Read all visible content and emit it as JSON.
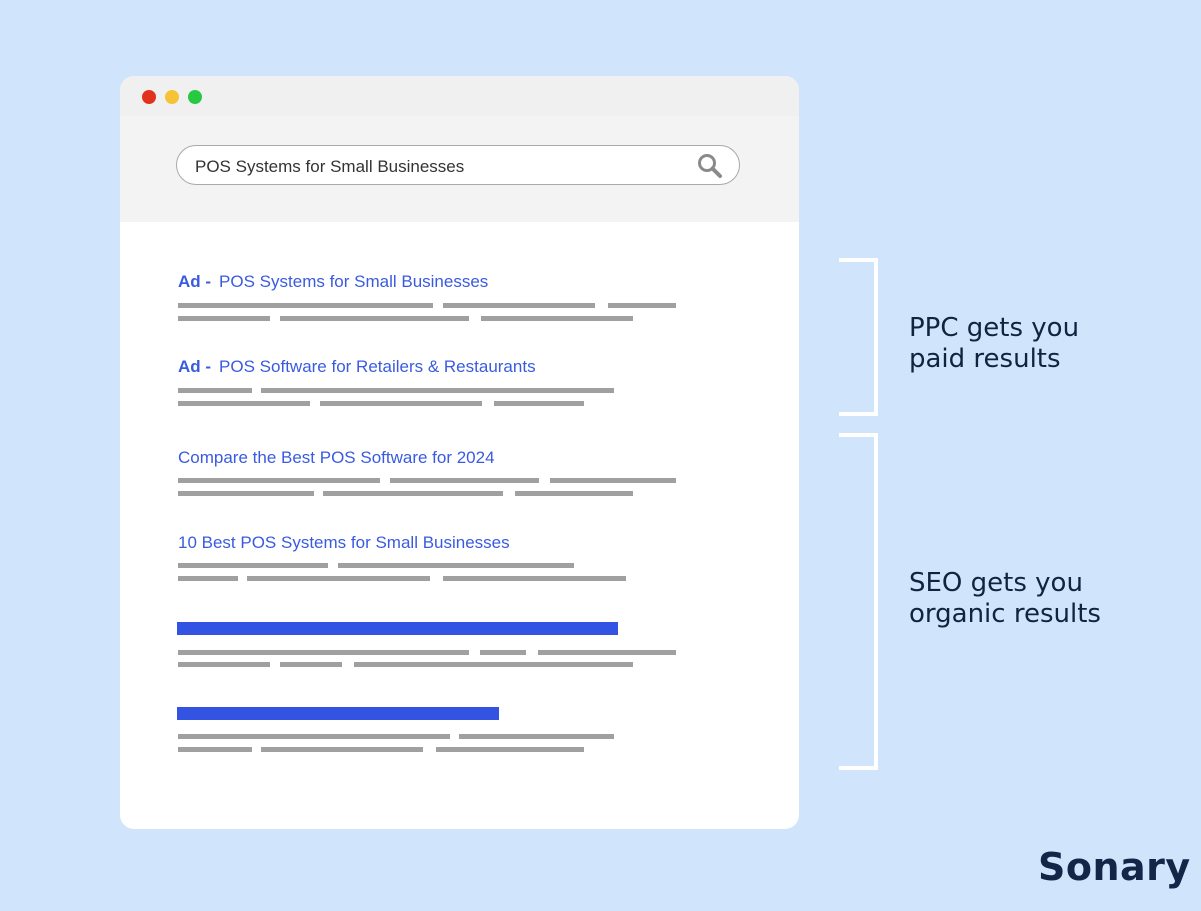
{
  "search": {
    "query": "POS Systems for Small Businesses"
  },
  "results": [
    {
      "ad": "Ad -",
      "title": "POS Systems for Small Businesses"
    },
    {
      "ad": "Ad -",
      "title": "POS Software for Retailers & Restaurants"
    },
    {
      "title": "Compare the Best POS Software for 2024"
    },
    {
      "title": "10 Best POS Systems for Small Businesses"
    }
  ],
  "labels": {
    "ppc": {
      "line1": "PPC gets you",
      "line2": "paid results"
    },
    "seo": {
      "line1": "SEO gets you",
      "line2": "organic results"
    }
  },
  "brand": {
    "name": "Sonary"
  },
  "colors": {
    "background": "#d0e4fb",
    "link": "#3a5be0",
    "accent_bar": "#3354e3",
    "text_dark": "#102440"
  }
}
